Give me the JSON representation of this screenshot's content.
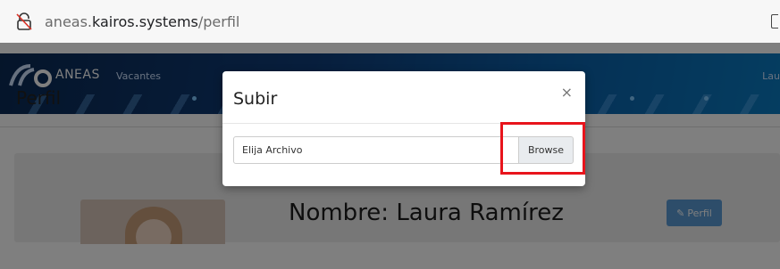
{
  "browser": {
    "url_scheme_host_prefix": "aneas.",
    "url_host": "kairos.systems",
    "url_path": "/perfil",
    "lock_icon": "lock-broken-icon"
  },
  "app": {
    "brand": "ANEAS",
    "nav_items": [
      "Vacantes"
    ],
    "nav_right": "Lau",
    "page_title": "Perfil",
    "profile_name": "Nombre: Laura Ramírez",
    "profile_button_label": "Perfil",
    "profile_button_icon": "pencil-icon"
  },
  "modal": {
    "title": "Subir",
    "close_label": "×",
    "file_placeholder": "Elija Archivo",
    "browse_label": "Browse"
  },
  "colors": {
    "highlight": "#e8141c",
    "navbar": "#0f3d7a",
    "profile_button": "#5a9bd5"
  }
}
